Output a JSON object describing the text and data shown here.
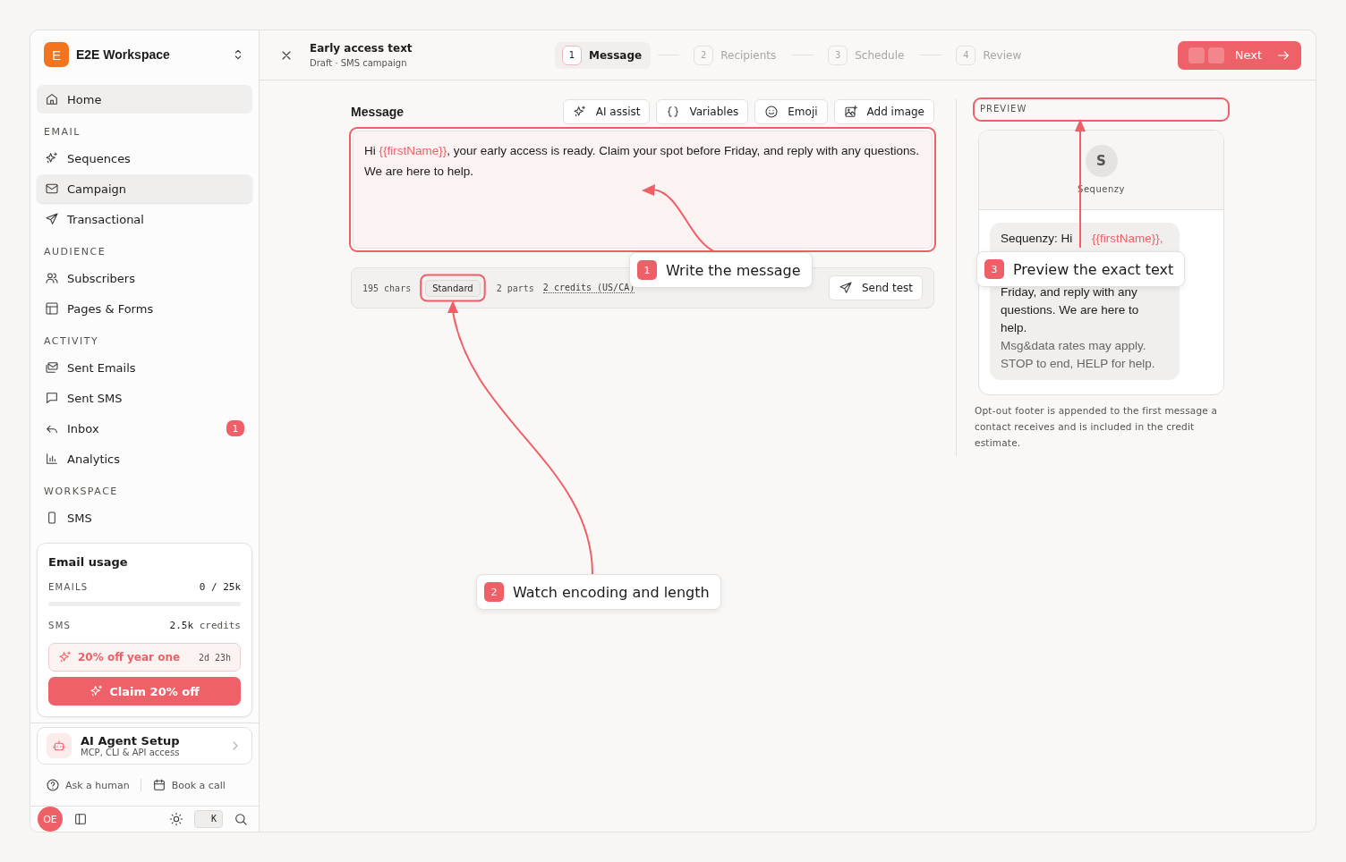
{
  "workspace": {
    "initial": "E",
    "name": "E2E Workspace"
  },
  "nav": [
    {
      "items": [
        {
          "label": "Home",
          "selected": false,
          "hovered": true
        }
      ]
    },
    {
      "title": "EMAIL",
      "items": [
        {
          "label": "Sequences",
          "selected": false,
          "hovered": false
        },
        {
          "label": "Campaign",
          "selected": true,
          "hovered": false
        },
        {
          "label": "Transactional",
          "selected": false,
          "hovered": false
        }
      ]
    },
    {
      "title": "AUDIENCE",
      "items": [
        {
          "label": "Subscribers",
          "selected": false,
          "hovered": false
        },
        {
          "label": "Pages & Forms",
          "selected": false,
          "hovered": false
        }
      ]
    },
    {
      "title": "ACTIVITY",
      "items": [
        {
          "label": "Sent Emails",
          "selected": false,
          "hovered": false
        },
        {
          "label": "Sent SMS",
          "selected": false,
          "hovered": false
        },
        {
          "label": "Inbox",
          "selected": false,
          "hovered": false,
          "badge": "1"
        },
        {
          "label": "Analytics",
          "selected": false,
          "hovered": false
        }
      ]
    },
    {
      "title": "WORKSPACE",
      "items": [
        {
          "label": "SMS",
          "selected": false,
          "hovered": false
        }
      ]
    }
  ],
  "usage": {
    "title": "Email usage",
    "rows": [
      {
        "label": "EMAILS",
        "value": "0 / 25k",
        "level": 0
      },
      {
        "label": "SMS",
        "value": "2.5k",
        "unit": "credits"
      }
    ],
    "promo": {
      "text": "20% off year one",
      "timer": "2d 23h"
    },
    "button": "Claim 20% off"
  },
  "agent": {
    "title": "AI Agent Setup",
    "subtitle": "MCP, CLI & API access"
  },
  "help_links": [
    "Ask a human",
    "Book a call"
  ],
  "bottom_bar": {
    "avatar": "OE",
    "shortcut": "K"
  },
  "header": {
    "title": "Early access text",
    "subtitle": "Draft · SMS campaign",
    "steps": [
      {
        "number": "1",
        "label": "Message",
        "selected": true
      },
      {
        "number": "2",
        "label": "Recipients",
        "selected": false
      },
      {
        "number": "3",
        "label": "Schedule",
        "selected": false
      },
      {
        "number": "4",
        "label": "Review",
        "selected": false
      }
    ],
    "next": "Next"
  },
  "editor": {
    "label": "Message",
    "tools": [
      "AI assist",
      "Variables",
      "Emoji",
      "Add image"
    ],
    "message": [
      {
        "kind": "text",
        "text": "Hi "
      },
      {
        "kind": "variable",
        "text": "{{firstName}}"
      },
      {
        "kind": "text",
        "text": ", your early access is ready. Claim your spot before Friday, and reply with any questions. We are here to help."
      }
    ],
    "stats": {
      "chars": "195 chars",
      "encoding": "Standard",
      "parts": "2 parts",
      "credits": "2 credits (US/CA)"
    },
    "send_test": "Send test"
  },
  "preview": {
    "label": "PREVIEW",
    "avatar": "S",
    "sender": "Sequenzy",
    "bubble_lines": [
      {
        "kind": "first",
        "parts": [
          {
            "kind": "text",
            "text": "Sequenzy: Hi "
          },
          {
            "kind": "variable",
            "text": "{{firstName}},"
          }
        ]
      },
      {
        "kind": "hidden"
      },
      {
        "kind": "body",
        "text": "Friday, and reply with any"
      },
      {
        "kind": "body",
        "text": "questions. We are here to"
      },
      {
        "kind": "body",
        "text": "help."
      },
      {
        "kind": "footer",
        "text": "Msg&data rates may apply."
      },
      {
        "kind": "footer",
        "text": "STOP to end, HELP for help."
      }
    ],
    "note": "Opt-out footer is appended to the first message a contact receives and is included in the credit estimate."
  },
  "callouts": [
    {
      "number": "1",
      "text": "Write the message"
    },
    {
      "number": "2",
      "text": "Watch encoding and length"
    },
    {
      "number": "3",
      "text": "Preview the exact text"
    }
  ]
}
